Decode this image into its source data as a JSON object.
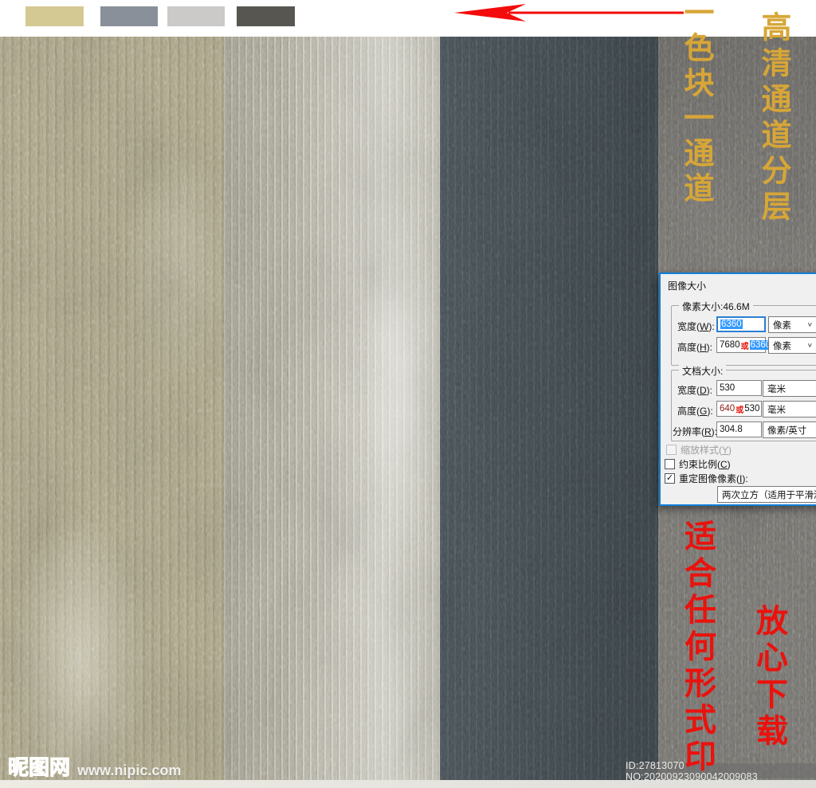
{
  "topbar": {
    "swatches": [
      {
        "name": "khaki",
        "color": "#d5c993"
      },
      {
        "name": "gray-blue",
        "color": "#89909a"
      },
      {
        "name": "light-gray",
        "color": "#cbcac8"
      },
      {
        "name": "dark-gray",
        "color": "#575651"
      }
    ],
    "arrow_color": "#f40b0b"
  },
  "texture": {
    "stripes": [
      {
        "name": "khaki-fabric",
        "color": "#a69f80"
      },
      {
        "name": "silver-fabric",
        "color": "#aeab9b"
      },
      {
        "name": "dark-slate-fabric",
        "color": "#40494e"
      },
      {
        "name": "warm-gray-fabric",
        "color": "#73716d"
      }
    ]
  },
  "overlay": {
    "gold_col1": "一色块一通道",
    "gold_col2": "高清通道分层",
    "red_col1": "适合任何形式印",
    "red_col2": "放心下载",
    "gold_color": "#d7a637",
    "red_color": "#ea120d"
  },
  "dialog": {
    "title": "图像大小",
    "pixel_group": {
      "label": "像素大小:46.6M",
      "width": {
        "pre": "宽度(",
        "key": "W",
        "post": "):",
        "value": "6360",
        "unit": "像素"
      },
      "height": {
        "pre": "高度(",
        "key": "H",
        "post": "):",
        "old": "7680",
        "sep": "或",
        "new": "6360",
        "unit": "像素"
      }
    },
    "doc_group": {
      "label": "文档大小:",
      "width": {
        "pre": "宽度(",
        "key": "D",
        "post": "):",
        "value": "530",
        "unit": "毫米"
      },
      "height": {
        "pre": "高度(",
        "key": "G",
        "post": "):",
        "old": "640",
        "sep": "或",
        "new": "530",
        "unit": "毫米"
      },
      "resolution": {
        "pre": "分辨率(",
        "key": "R",
        "post": "):",
        "value": "304.8",
        "unit": "像素/英寸"
      }
    },
    "checkboxes": [
      {
        "pre": "缩放样式(",
        "key": "Y",
        "post": ")",
        "checked": "",
        "state": "disabled"
      },
      {
        "pre": "约束比例(",
        "key": "C",
        "post": ")",
        "checked": "",
        "state": "unchecked"
      },
      {
        "pre": "重定图像像素(",
        "key": "I",
        "post": "):",
        "checked": "✓",
        "state": "checked"
      }
    ],
    "resample_value": "两次立方（适用于平滑渐变",
    "chevron": "∨"
  },
  "footer": {
    "site_name": "昵图网",
    "site_url": "www.nipic.com",
    "id_text": "ID:27813070 NO:20200923090042009083"
  }
}
